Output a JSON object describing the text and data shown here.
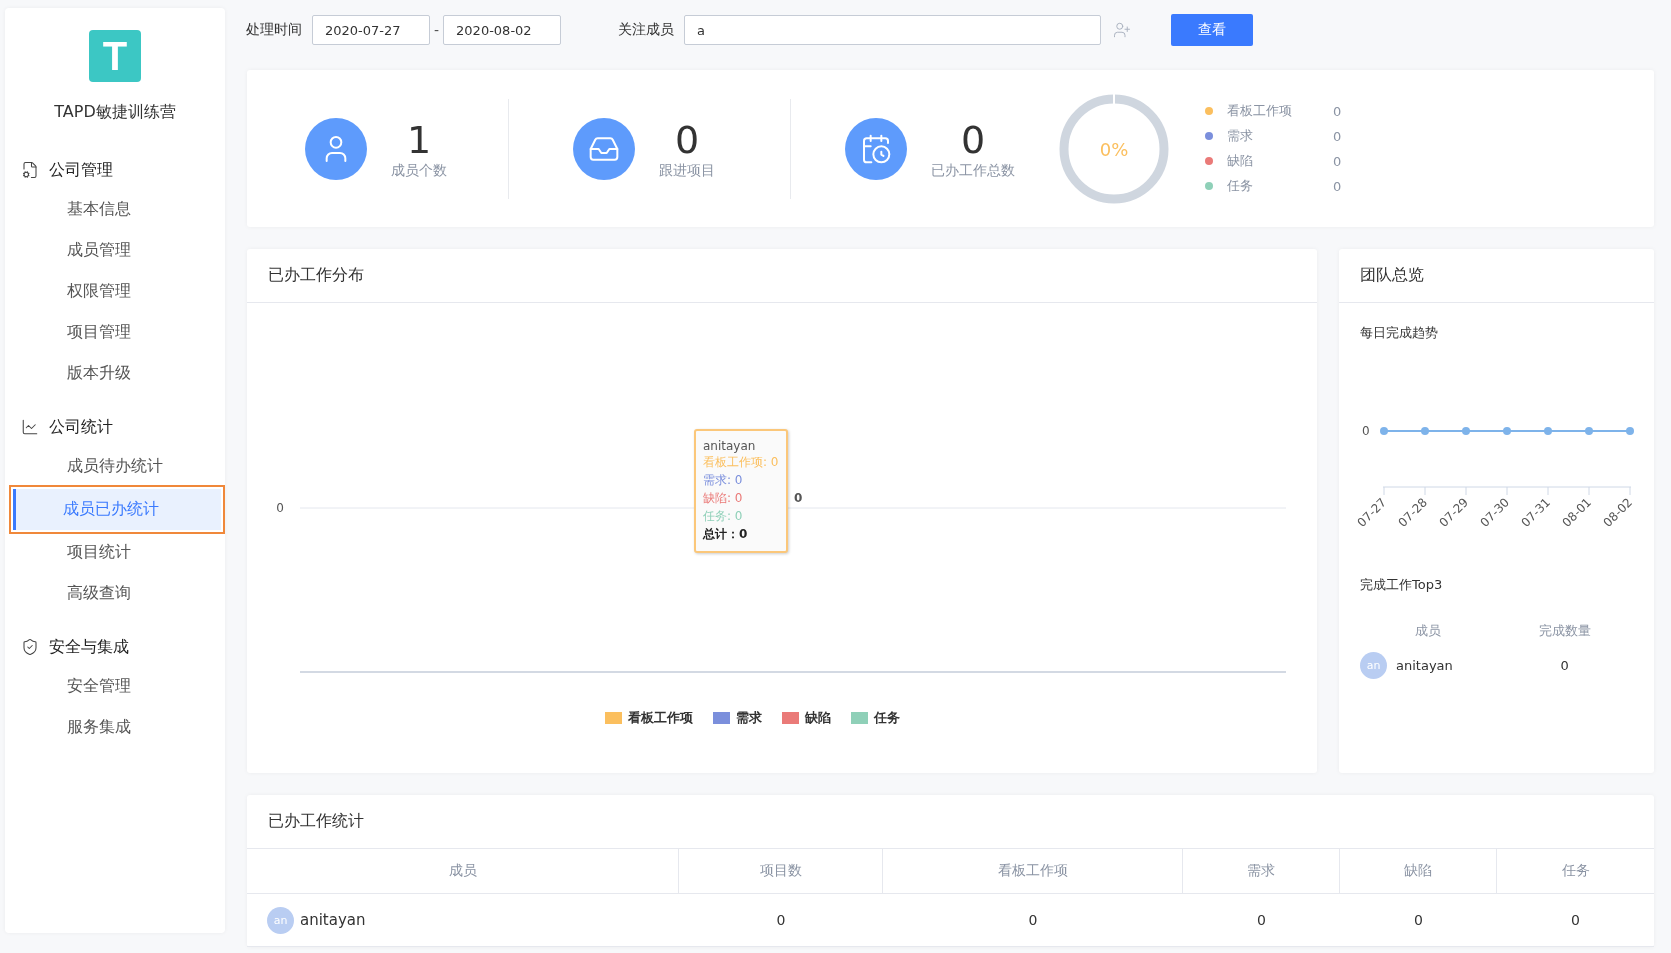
{
  "sidebar": {
    "logo": "T",
    "title": "TAPD敏捷训练营",
    "groups": [
      {
        "label": "公司管理",
        "items": [
          {
            "label": "基本信息",
            "selected": false,
            "highlighted": false
          },
          {
            "label": "成员管理",
            "selected": false,
            "highlighted": false
          },
          {
            "label": "权限管理",
            "selected": false,
            "highlighted": false
          },
          {
            "label": "项目管理",
            "selected": false,
            "highlighted": false
          },
          {
            "label": "版本升级",
            "selected": false,
            "highlighted": false
          }
        ]
      },
      {
        "label": "公司统计",
        "items": [
          {
            "label": "成员待办统计",
            "selected": false,
            "highlighted": false
          },
          {
            "label": "成员已办统计",
            "selected": true,
            "highlighted": true
          },
          {
            "label": "项目统计",
            "selected": false,
            "highlighted": false
          },
          {
            "label": "高级查询",
            "selected": false,
            "highlighted": false
          }
        ]
      },
      {
        "label": "安全与集成",
        "items": [
          {
            "label": "安全管理",
            "selected": false,
            "highlighted": false
          },
          {
            "label": "服务集成",
            "selected": false,
            "highlighted": false
          }
        ]
      }
    ]
  },
  "filters": {
    "time_label": "处理时间",
    "start_date": "2020-07-27",
    "separator": "-",
    "end_date": "2020-08-02",
    "member_label": "关注成员",
    "member_value": "a",
    "submit": "查看"
  },
  "summary": {
    "stats": [
      {
        "value": "1",
        "label": "成员个数"
      },
      {
        "value": "0",
        "label": "跟进项目"
      },
      {
        "value": "0",
        "label": "已办工作总数"
      }
    ],
    "ring_text": "0%",
    "legend": [
      {
        "label": "看板工作项",
        "value": "0",
        "color": "#fbbf5e"
      },
      {
        "label": "需求",
        "value": "0",
        "color": "#7b8fdc"
      },
      {
        "label": "缺陷",
        "value": "0",
        "color": "#ea7a78"
      },
      {
        "label": "任务",
        "value": "0",
        "color": "#8fd0b8"
      }
    ]
  },
  "distribution": {
    "title": "已办工作分布",
    "y_axis_label": "0",
    "legend": [
      {
        "name": "看板工作项",
        "color": "#fbbf5e"
      },
      {
        "name": "需求",
        "color": "#7b8fdc"
      },
      {
        "name": "缺陷",
        "color": "#ea7a78"
      },
      {
        "name": "任务",
        "color": "#8fd0b8"
      }
    ],
    "total_label": "0",
    "tooltip": {
      "title": "anitayan",
      "lines": [
        {
          "text": "看板工作项: 0",
          "color": "#fbbf5e"
        },
        {
          "text": "需求: 0",
          "color": "#7b8fdc"
        },
        {
          "text": "缺陷: 0",
          "color": "#ea7a78"
        },
        {
          "text": "任务: 0",
          "color": "#8fd0b8"
        }
      ],
      "total": "总计：0"
    }
  },
  "team": {
    "title": "团队总览",
    "trend_title": "每日完成趋势",
    "y_axis_label": "0",
    "x_labels": [
      "07-27",
      "07-28",
      "07-29",
      "07-30",
      "07-31",
      "08-01",
      "08-02"
    ],
    "top_title": "完成工作Top3",
    "columns": [
      "成员",
      "完成数量"
    ],
    "rows": [
      {
        "avatar": "an",
        "name": "anitayan",
        "count": "0"
      }
    ]
  },
  "table": {
    "title": "已办工作统计",
    "columns": [
      "成员",
      "项目数",
      "看板工作项",
      "需求",
      "缺陷",
      "任务"
    ],
    "rows": [
      {
        "avatar": "an",
        "cells": [
          "anitayan",
          "0",
          "0",
          "0",
          "0",
          "0"
        ]
      }
    ]
  }
}
